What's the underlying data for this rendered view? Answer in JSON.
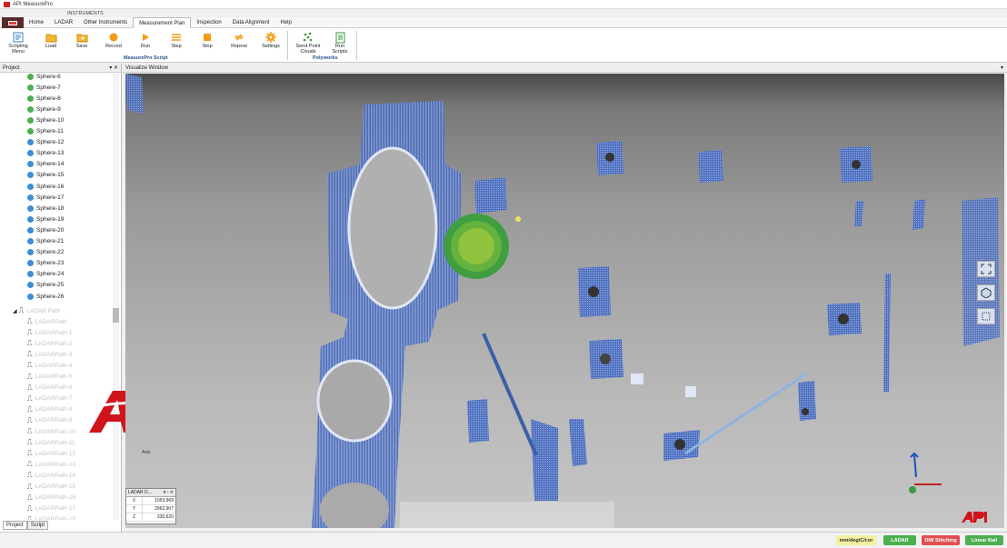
{
  "window": {
    "title": "API MeasurePro"
  },
  "context_tab": "INSTRUMENTS",
  "menu": {
    "tabs": [
      "Home",
      "LADAR",
      "Other Instruments",
      "Measurement Plan",
      "Inspection",
      "Data Alignment",
      "Help"
    ],
    "active": "Measurement Plan"
  },
  "ribbon": {
    "buttons": [
      {
        "label": "Scripting Menu",
        "icon": "scripting-icon"
      },
      {
        "label": "Load",
        "icon": "folder-icon"
      },
      {
        "label": "Save",
        "icon": "save-icon"
      },
      {
        "label": "Record",
        "icon": "record-icon"
      },
      {
        "label": "Run",
        "icon": "play-icon"
      },
      {
        "label": "Step",
        "icon": "step-icon"
      },
      {
        "label": "Stop",
        "icon": "stop-icon"
      },
      {
        "label": "Repeat",
        "icon": "repeat-icon"
      },
      {
        "label": "Settings",
        "icon": "gear-icon"
      },
      {
        "label": "Send Point Clouds",
        "icon": "point-cloud-icon"
      },
      {
        "label": "Run Scripts",
        "icon": "run-scripts-icon"
      }
    ],
    "groups": {
      "script": "MeasurePro Script",
      "polyworks": "Polyworks"
    }
  },
  "project_panel": {
    "title": "Project",
    "spheres": [
      {
        "name": "Sphere-6",
        "color": "#4caf50"
      },
      {
        "name": "Sphere-7",
        "color": "#4caf50"
      },
      {
        "name": "Sphere-8",
        "color": "#4caf50"
      },
      {
        "name": "Sphere-9",
        "color": "#4caf50"
      },
      {
        "name": "Sphere-10",
        "color": "#4caf50"
      },
      {
        "name": "Sphere-11",
        "color": "#4caf50"
      },
      {
        "name": "Sphere-12",
        "color": "#3a8fd6"
      },
      {
        "name": "Sphere-13",
        "color": "#3a8fd6"
      },
      {
        "name": "Sphere-14",
        "color": "#3a8fd6"
      },
      {
        "name": "Sphere-15",
        "color": "#3a8fd6"
      },
      {
        "name": "Sphere-16",
        "color": "#3a8fd6"
      },
      {
        "name": "Sphere-17",
        "color": "#3a8fd6"
      },
      {
        "name": "Sphere-18",
        "color": "#3a8fd6"
      },
      {
        "name": "Sphere-19",
        "color": "#3a8fd6"
      },
      {
        "name": "Sphere-20",
        "color": "#3a8fd6"
      },
      {
        "name": "Sphere-21",
        "color": "#3a8fd6"
      },
      {
        "name": "Sphere-22",
        "color": "#3a8fd6"
      },
      {
        "name": "Sphere-23",
        "color": "#3a8fd6"
      },
      {
        "name": "Sphere-24",
        "color": "#3a8fd6"
      },
      {
        "name": "Sphere-25",
        "color": "#3a8fd6"
      },
      {
        "name": "Sphere-26",
        "color": "#3a8fd6"
      }
    ],
    "ladar_group": "LADAR Path",
    "ladar_paths": [
      "LADARPath",
      "LADARPath-1",
      "LADARPath-2",
      "LADARPath-3",
      "LADARPath-4",
      "LADARPath-5",
      "LADARPath-6",
      "LADARPath-7",
      "LADARPath-8",
      "LADARPath-9",
      "LADARPath-10",
      "LADARPath-11",
      "LADARPath-12",
      "LADARPath-13",
      "LADARPath-14",
      "LADARPath-15",
      "LADARPath-16",
      "LADARPath-17",
      "LADARPath-18"
    ],
    "tabs": [
      "Project",
      "Script"
    ],
    "active_tab": "Project"
  },
  "logo_text": "API",
  "visualize": {
    "title": "Visualize Window",
    "nav_icons": [
      "fit-view-icon",
      "view-cube-icon",
      "zoom-box-icon"
    ],
    "readout": {
      "title": "LADAR D...",
      "rows": [
        {
          "axis": "X",
          "value": "1053.969"
        },
        {
          "axis": "Y",
          "value": "2962.907"
        },
        {
          "axis": "Z",
          "value": "330.620"
        }
      ]
    }
  },
  "status": {
    "units": "mm/deg/C/cor",
    "instrument": "LADAR",
    "stitching": "DMI Stitching",
    "linear": "Linear Rail",
    "colors": {
      "units": "#f4f0a0",
      "instrument": "#4caf50",
      "stitching": "#e05050",
      "linear": "#4caf50"
    }
  }
}
